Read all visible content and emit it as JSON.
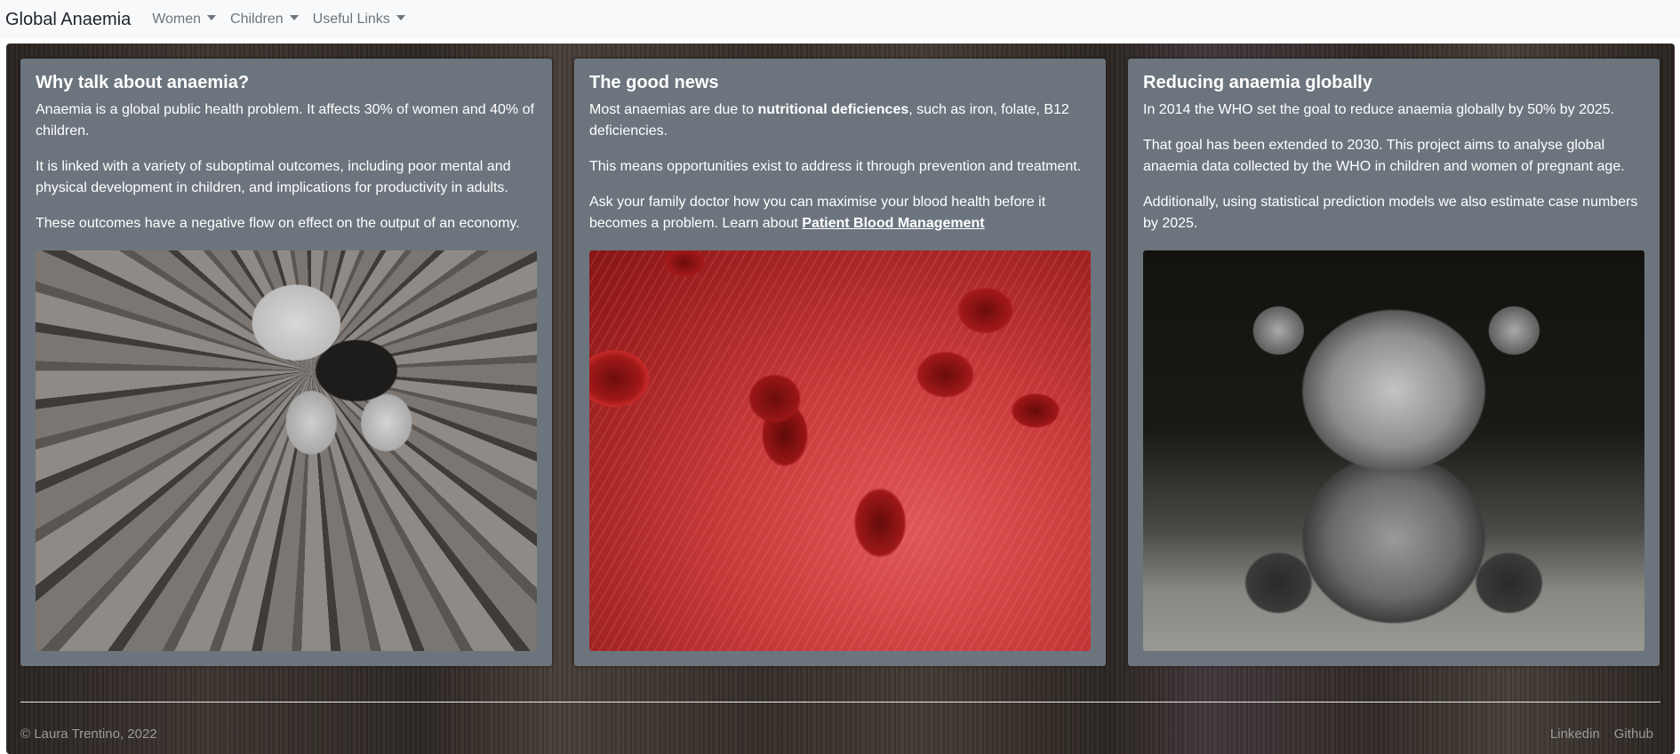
{
  "navbar": {
    "brand": "Global Anaemia",
    "items": [
      {
        "label": "Women"
      },
      {
        "label": "Children"
      },
      {
        "label": "Useful Links"
      }
    ]
  },
  "cards": [
    {
      "title": "Why talk about anaemia?",
      "paragraphs": [
        "Anaemia is a global public health problem. It affects 30% of women and 40% of children.",
        "It is linked with a variety of suboptimal outcomes, including poor mental and physical development in children, and implications for productivity in adults.",
        "These outcomes have a negative flow on effect on the output of an economy."
      ]
    },
    {
      "title": "The good news",
      "p1_before": "Most anaemias are due to ",
      "p1_bold": "nutritional deficiences",
      "p1_after": ", such as iron, folate, B12 deficiencies.",
      "p2": "This means opportunities exist to address it through prevention and treatment.",
      "p3_before": "Ask your family doctor how you can maximise your blood health before it becomes a problem. Learn about ",
      "p3_link": "Patient Blood Management"
    },
    {
      "title": "Reducing anaemia globally",
      "paragraphs": [
        "In 2014 the WHO set the goal to reduce anaemia globally by 50% by 2025.",
        "That goal has been extended to 2030. This project aims to analyse global anaemia data collected by the WHO in children and women of pregnant age.",
        "Additionally, using statistical prediction models we also estimate case numbers by 2025."
      ]
    }
  ],
  "footer": {
    "copyright": "© Laura Trentino, 2022",
    "links": [
      "Linkedin",
      "Github"
    ]
  },
  "colors": {
    "card_bg": "#6c757d",
    "navbar_bg": "#f8f9fa"
  }
}
